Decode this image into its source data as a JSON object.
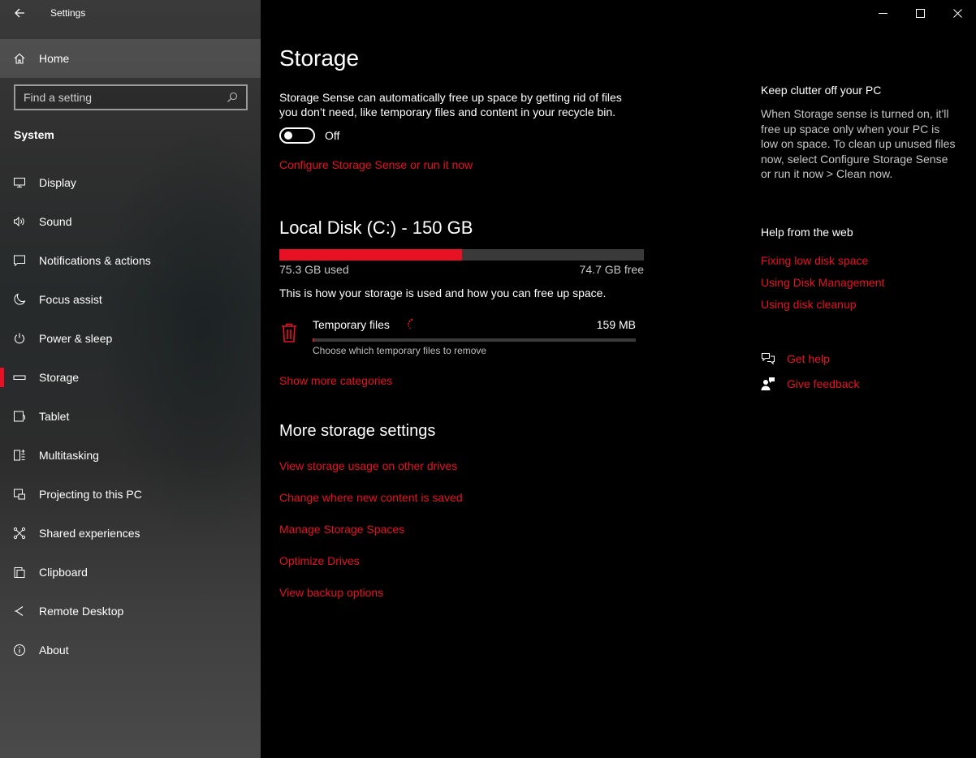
{
  "window": {
    "title": "Settings",
    "minimize_icon": "minimize-icon",
    "maximize_icon": "maximize-icon",
    "close_icon": "close-icon"
  },
  "sidebar": {
    "home_label": "Home",
    "search_placeholder": "Find a setting",
    "section_title": "System",
    "items": [
      {
        "label": "Display",
        "icon": "display-icon"
      },
      {
        "label": "Sound",
        "icon": "sound-icon"
      },
      {
        "label": "Notifications & actions",
        "icon": "notifications-icon"
      },
      {
        "label": "Focus assist",
        "icon": "moon-icon"
      },
      {
        "label": "Power & sleep",
        "icon": "power-icon"
      },
      {
        "label": "Storage",
        "icon": "storage-icon",
        "selected": true
      },
      {
        "label": "Tablet",
        "icon": "tablet-icon"
      },
      {
        "label": "Multitasking",
        "icon": "multitasking-icon"
      },
      {
        "label": "Projecting to this PC",
        "icon": "projecting-icon"
      },
      {
        "label": "Shared experiences",
        "icon": "shared-icon"
      },
      {
        "label": "Clipboard",
        "icon": "clipboard-icon"
      },
      {
        "label": "Remote Desktop",
        "icon": "remote-desktop-icon"
      },
      {
        "label": "About",
        "icon": "info-icon"
      }
    ]
  },
  "main": {
    "title": "Storage",
    "sense_description": "Storage Sense can automatically free up space by getting rid of files you don’t need, like temporary files and content in your recycle bin.",
    "toggle_state": "Off",
    "configure_link": "Configure Storage Sense or run it now",
    "disk": {
      "title": "Local Disk (C:) - 150 GB",
      "used_label": "75.3 GB used",
      "free_label": "74.7 GB free",
      "used_fraction": 0.502
    },
    "usage_description": "This is how your storage is used and how you can free up space.",
    "temp_files": {
      "name": "Temporary files",
      "size": "159 MB",
      "subtitle": "Choose which temporary files to remove",
      "fraction": 0.004
    },
    "show_more": "Show more categories",
    "more_title": "More storage settings",
    "more_links": [
      "View storage usage on other drives",
      "Change where new content is saved",
      "Manage Storage Spaces",
      "Optimize Drives",
      "View backup options"
    ]
  },
  "right": {
    "clutter_title": "Keep clutter off your PC",
    "clutter_description": "When Storage sense is turned on, it'll free up space only when your PC is low on space. To clean up unused files now, select Configure Storage Sense or run it now > Clean now.",
    "web_title": "Help from the web",
    "web_links": [
      "Fixing low disk space",
      "Using Disk Management",
      "Using disk cleanup"
    ],
    "get_help": "Get help",
    "give_feedback": "Give feedback"
  },
  "colors": {
    "accent": "#e81123",
    "background": "#000000",
    "bar_track": "#3a3a3a"
  }
}
